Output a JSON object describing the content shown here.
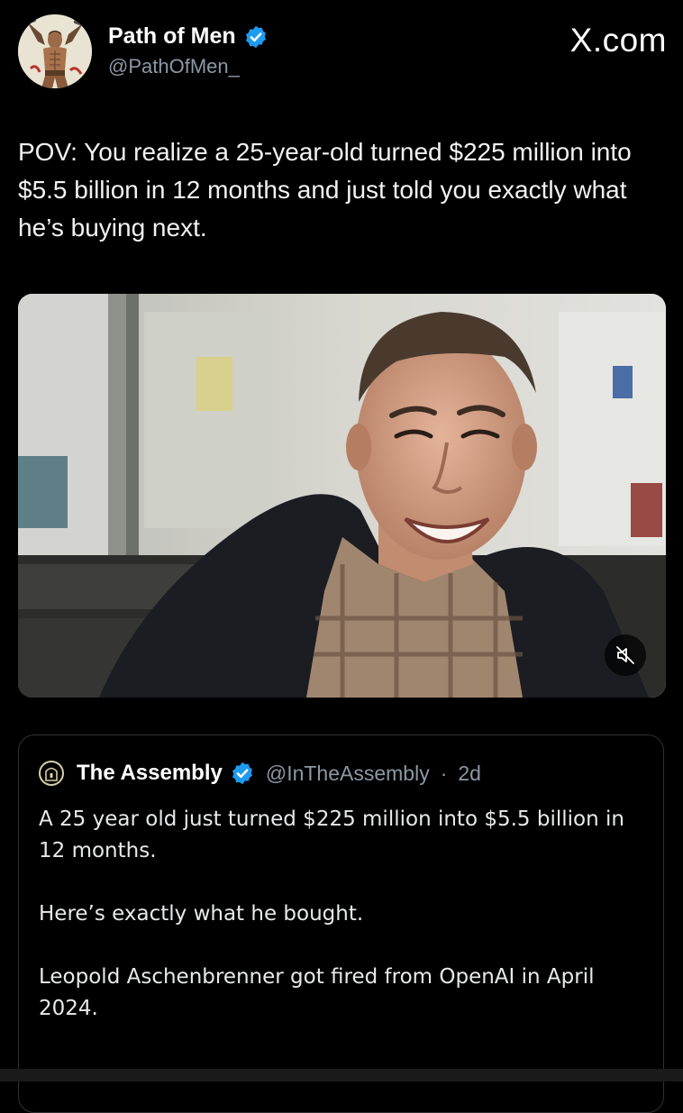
{
  "post": {
    "author": {
      "display_name": "Path of Men",
      "handle": "@PathOfMen_",
      "verified_icon": "verified-badge-icon",
      "avatar_icon": "illustrated-warrior-avatar"
    },
    "watermark": "X.com",
    "text": "POV: You realize a 25-year-old turned $225 million into $5.5 billion in 12 months and just told you exactly what he’s buying next.",
    "media": {
      "type": "video",
      "description_icon": "smiling-man-video-frame",
      "mute_icon": "speaker-muted-icon"
    }
  },
  "quote": {
    "author": {
      "display_name": "The Assembly",
      "handle": "@InTheAssembly",
      "separator": "·",
      "age": "2d",
      "avatar_icon": "assembly-logo-icon",
      "verified_icon": "verified-badge-icon"
    },
    "paragraphs": [
      "A 25 year old just turned $225 million into $5.5 billion in 12 months.",
      "Here’s exactly what he bought.",
      "Leopold Aschenbrenner got fired from OpenAI in April 2024."
    ]
  },
  "colors": {
    "background": "#000000",
    "verified": "#1d9bf0",
    "secondary_text": "#8b98a5",
    "border": "#2f3336"
  }
}
